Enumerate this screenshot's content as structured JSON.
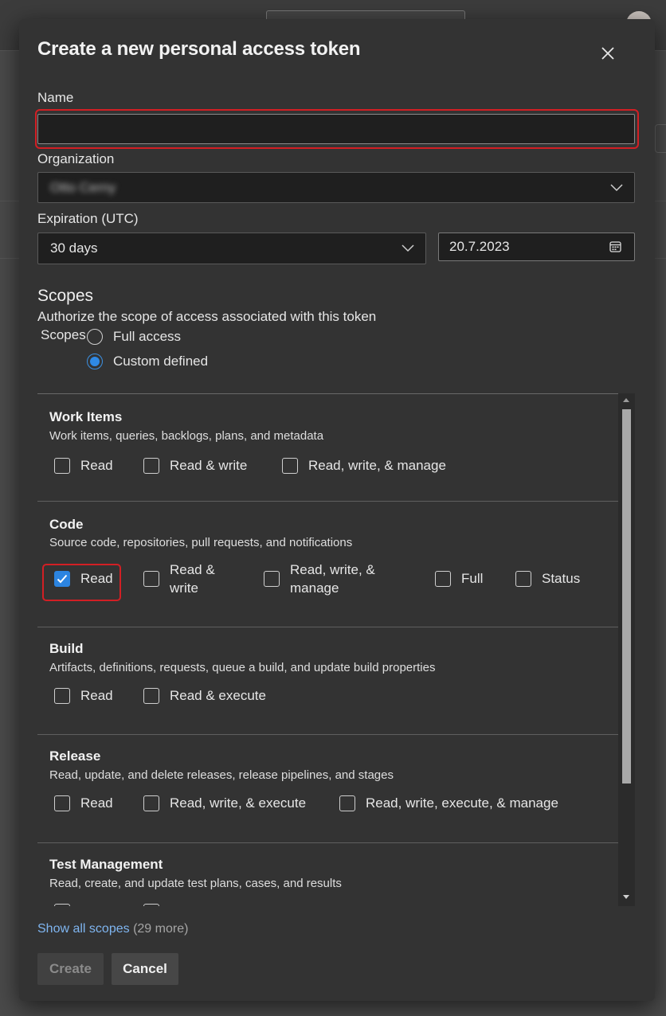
{
  "dialog": {
    "title": "Create a new personal access token",
    "name_label": "Name",
    "name_value": "",
    "organization_label": "Organization",
    "organization_value": "Otto Cerny",
    "expiration_label": "Expiration (UTC)",
    "expiration_value": "30 days",
    "expiration_date": "20.7.2023"
  },
  "scopes": {
    "heading": "Scopes",
    "description": "Authorize the scope of access associated with this token",
    "radio_group_label": "Scopes",
    "options": [
      {
        "label": "Full access",
        "selected": false
      },
      {
        "label": "Custom defined",
        "selected": true
      }
    ],
    "sections": [
      {
        "title": "Work Items",
        "description": "Work items, queries, backlogs, plans, and metadata",
        "options": [
          {
            "label": "Read",
            "checked": false
          },
          {
            "label": "Read & write",
            "checked": false
          },
          {
            "label": "Read, write, & manage",
            "checked": false
          }
        ]
      },
      {
        "title": "Code",
        "description": "Source code, repositories, pull requests, and notifications",
        "options": [
          {
            "label": "Read",
            "checked": true
          },
          {
            "label": "Read & write",
            "checked": false
          },
          {
            "label": "Read, write, & manage",
            "checked": false
          },
          {
            "label": "Full",
            "checked": false
          },
          {
            "label": "Status",
            "checked": false
          }
        ]
      },
      {
        "title": "Build",
        "description": "Artifacts, definitions, requests, queue a build, and update build properties",
        "options": [
          {
            "label": "Read",
            "checked": false
          },
          {
            "label": "Read & execute",
            "checked": false
          }
        ]
      },
      {
        "title": "Release",
        "description": "Read, update, and delete releases, release pipelines, and stages",
        "options": [
          {
            "label": "Read",
            "checked": false
          },
          {
            "label": "Read, write, & execute",
            "checked": false
          },
          {
            "label": "Read, write, execute, & manage",
            "checked": false
          }
        ]
      },
      {
        "title": "Test Management",
        "description": "Read, create, and update test plans, cases, and results",
        "options": []
      }
    ],
    "show_all_label": "Show all scopes",
    "more_count": "(29 more)"
  },
  "footer": {
    "create_label": "Create",
    "cancel_label": "Cancel"
  },
  "colors": {
    "accent": "#2c84e0",
    "highlight": "#d21f24",
    "dialog_bg": "#333333"
  }
}
